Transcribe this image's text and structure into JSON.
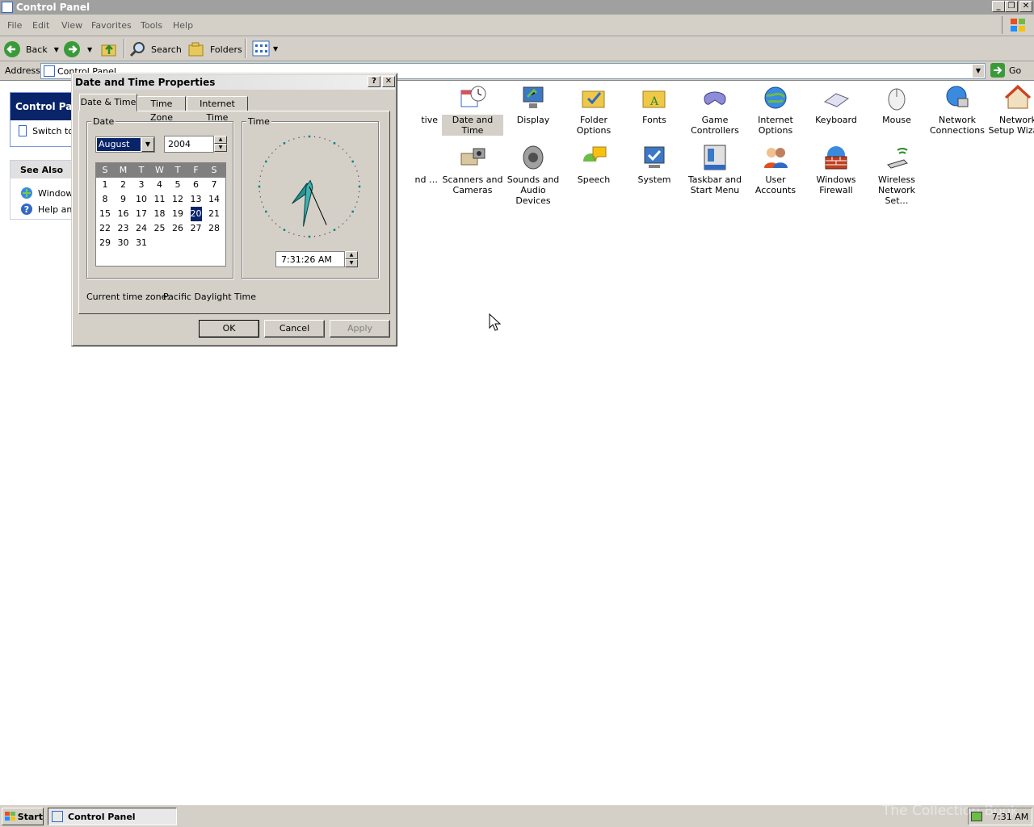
{
  "window": {
    "title": "Control Panel"
  },
  "menu": [
    "File",
    "Edit",
    "View",
    "Favorites",
    "Tools",
    "Help"
  ],
  "toolbar": {
    "back": "Back",
    "search": "Search",
    "folders": "Folders"
  },
  "address": {
    "label": "Address",
    "value": "Control Panel",
    "go": "Go"
  },
  "left_panel": {
    "title": "Control Panel",
    "switch": "Switch to",
    "see_also": "See Also",
    "links": [
      "Windows",
      "Help and"
    ]
  },
  "icons_row1": [
    {
      "label": "tive",
      "icon": "partial-icon"
    },
    {
      "label": "Date and Time",
      "icon": "date-time-icon"
    },
    {
      "label": "Display",
      "icon": "display-icon"
    },
    {
      "label": "Folder Options",
      "icon": "folder-options-icon"
    },
    {
      "label": "Fonts",
      "icon": "fonts-icon"
    },
    {
      "label": "Game Controllers",
      "icon": "game-controller-icon"
    },
    {
      "label": "Internet Options",
      "icon": "internet-options-icon"
    },
    {
      "label": "Keyboard",
      "icon": "keyboard-icon"
    },
    {
      "label": "Mouse",
      "icon": "mouse-icon"
    },
    {
      "label": "Network Connections",
      "icon": "network-connections-icon"
    },
    {
      "label": "Network Setup Wizard",
      "icon": "network-setup-icon"
    }
  ],
  "icons_row2": [
    {
      "label": "nd …",
      "icon": "partial-icon"
    },
    {
      "label": "Scanners and Cameras",
      "icon": "scanner-icon"
    },
    {
      "label": "Sounds and Audio Devices",
      "icon": "speaker-icon"
    },
    {
      "label": "Speech",
      "icon": "speech-icon"
    },
    {
      "label": "System",
      "icon": "system-icon"
    },
    {
      "label": "Taskbar and Start Menu",
      "icon": "taskbar-icon"
    },
    {
      "label": "User Accounts",
      "icon": "user-accounts-icon"
    },
    {
      "label": "Windows Firewall",
      "icon": "firewall-icon"
    },
    {
      "label": "Wireless Network Set…",
      "icon": "wireless-icon"
    }
  ],
  "dialog": {
    "title": "Date and Time Properties",
    "help": "?",
    "close": "✕",
    "tabs": [
      "Date & Time",
      "Time Zone",
      "Internet Time"
    ],
    "date_group": "Date",
    "time_group": "Time",
    "month": "August",
    "year": "2004",
    "weekdays": [
      "S",
      "M",
      "T",
      "W",
      "T",
      "F",
      "S"
    ],
    "days": [
      "1",
      "2",
      "3",
      "4",
      "5",
      "6",
      "7",
      "8",
      "9",
      "10",
      "11",
      "12",
      "13",
      "14",
      "15",
      "16",
      "17",
      "18",
      "19",
      "20",
      "21",
      "22",
      "23",
      "24",
      "25",
      "26",
      "27",
      "28",
      "29",
      "30",
      "31"
    ],
    "first_weekday": 0,
    "selected_day": "20",
    "time_value": "7:31:26 AM",
    "clock": {
      "hour": 7,
      "minute": 31,
      "second": 26
    },
    "timezone_label": "Current time zone:",
    "timezone_value": "Pacific Daylight Time",
    "ok": "OK",
    "cancel": "Cancel",
    "apply": "Apply"
  },
  "taskbar": {
    "start": "Start",
    "task": "Control Panel",
    "clock": "7:31 AM"
  },
  "watermark": "The Collection Book",
  "colors": {
    "selected": "#0a246a",
    "accent": "#316ac5"
  }
}
